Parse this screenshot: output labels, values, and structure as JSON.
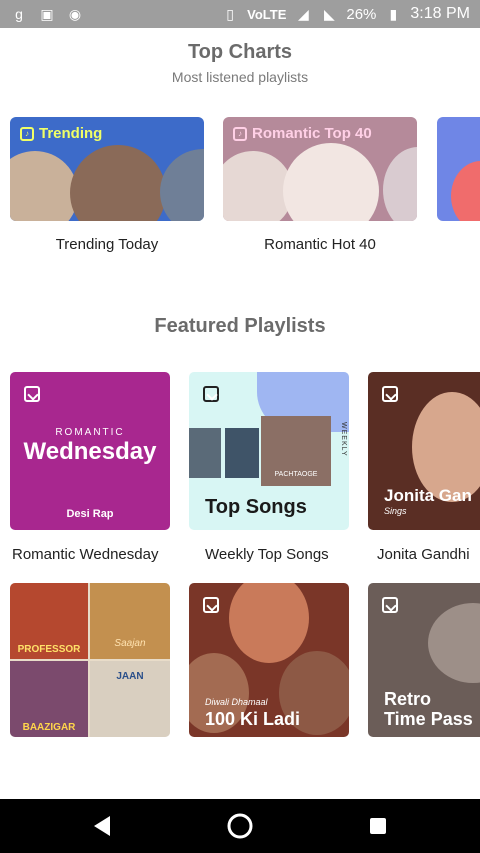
{
  "status_bar": {
    "left_icons": [
      "g-icon",
      "image-icon",
      "circle-icon"
    ],
    "network": "VoLTE",
    "battery": "26%",
    "time": "3:18 PM"
  },
  "top_charts": {
    "title": "Top Charts",
    "subtitle": "Most listened playlists",
    "cards": [
      {
        "badge": "Trending",
        "label": "Trending Today"
      },
      {
        "badge": "Romantic Top 40",
        "label": "Romantic Hot 40"
      }
    ]
  },
  "featured": {
    "title": "Featured Playlists",
    "row1": [
      {
        "label": "Romantic Wednesday",
        "art_kicker": "ROMANTIC",
        "art_title": "Wednesday",
        "art_sub": "Desi Rap"
      },
      {
        "label": "Weekly Top Songs",
        "art_title": "Top Songs",
        "art_side": "WEEKLY",
        "art_poster": "PACHTAOGE"
      },
      {
        "label": "Jonita Gandhi",
        "art_title": "Jonita Gan",
        "art_sub": "Sings"
      }
    ],
    "row2": [
      {
        "art_posters": [
          "PROFESSOR",
          "Saajan",
          "BAAZIGAR",
          "JAAN"
        ]
      },
      {
        "art_kicker": "Diwali Dhamaal",
        "art_title": "100 Ki Ladi"
      },
      {
        "art_title_line1": "Retro",
        "art_title_line2": "Time Pass"
      }
    ]
  },
  "colors": {
    "trending_bg": "#3d6bc9",
    "romantic_bg": "#b58a9a",
    "wednesday_bg": "#a8278f",
    "topsongs_bg": "#d8f6f4"
  }
}
